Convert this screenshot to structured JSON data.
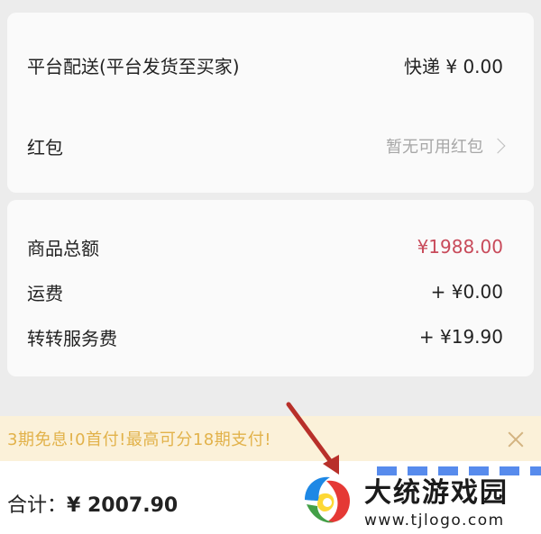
{
  "shipping": {
    "label": "平台配送(平台发货至买家)",
    "value": "快递 ¥ 0.00"
  },
  "red_packet": {
    "label": "红包",
    "value": "暂无可用红包"
  },
  "summary": {
    "goods_total": {
      "label": "商品总额",
      "value": "¥1988.00"
    },
    "freight": {
      "label": "运费",
      "value": "+ ¥0.00"
    },
    "service_fee": {
      "label": "转转服务费",
      "value": "+ ¥19.90"
    }
  },
  "promo": {
    "text": "3期免息!0首付!最高可分18期支付!"
  },
  "bottom": {
    "total_label": "合计：",
    "total_value": "¥ 2007.90"
  },
  "watermark": {
    "title": "大统游戏园",
    "url": "www.tjlogo.com"
  },
  "colors": {
    "price": "#c84a5a",
    "promo_text": "#e2b24a",
    "promo_bg": "#fbf1d9",
    "annotation_arrow": "#b8302a"
  }
}
